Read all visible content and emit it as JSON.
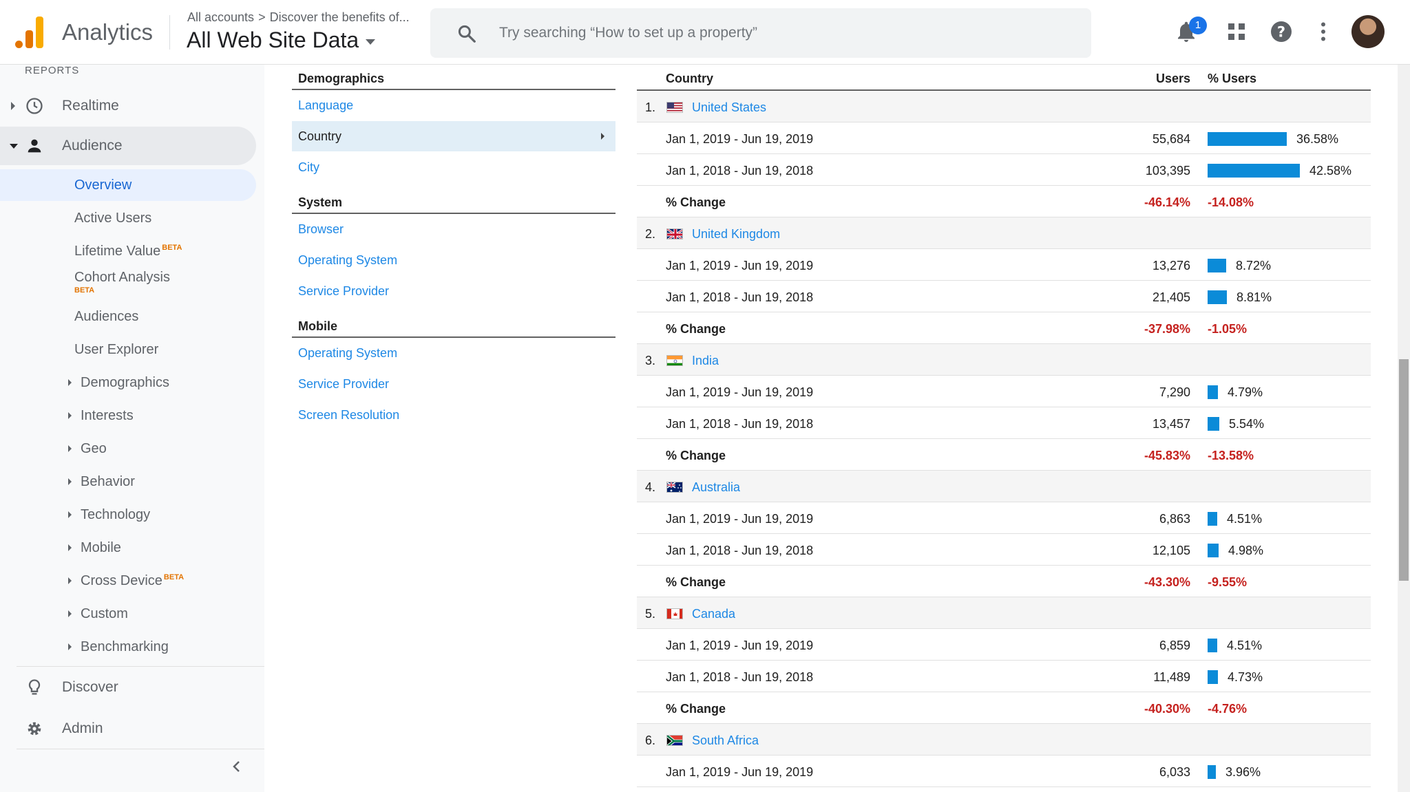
{
  "header": {
    "app_title": "Analytics",
    "breadcrumb_root": "All accounts",
    "breadcrumb_current": "Discover the benefits of...",
    "property": "All Web Site Data",
    "search_placeholder": "Try searching “How to set up a property”",
    "notification_count": "1",
    "icons": [
      "search-icon",
      "bell-icon",
      "apps-icon",
      "help-icon",
      "more-vert-icon"
    ]
  },
  "sidebar": {
    "section_label": "REPORTS",
    "realtime": "Realtime",
    "audience": "Audience",
    "audience_items": {
      "overview": "Overview",
      "active_users": "Active Users",
      "lifetime_value": "Lifetime Value",
      "cohort": "Cohort Analysis",
      "audiences": "Audiences",
      "user_explorer": "User Explorer",
      "demographics": "Demographics",
      "interests": "Interests",
      "geo": "Geo",
      "behavior": "Behavior",
      "technology": "Technology",
      "mobile": "Mobile",
      "cross_device": "Cross Device",
      "custom": "Custom",
      "benchmarking": "Benchmarking"
    },
    "beta_label": "BETA",
    "discover": "Discover",
    "admin": "Admin"
  },
  "dimension_panel": {
    "demographics_title": "Demographics",
    "language": "Language",
    "country": "Country",
    "city": "City",
    "system_title": "System",
    "browser": "Browser",
    "os": "Operating System",
    "provider": "Service Provider",
    "mobile_title": "Mobile",
    "mobile_os": "Operating System",
    "mobile_provider": "Service Provider",
    "screen_res": "Screen Resolution"
  },
  "table": {
    "col_country": "Country",
    "col_users": "Users",
    "col_pct_users": "% Users",
    "change_label": "% Change",
    "bar_color": "#0b8bd8",
    "change_color": "#c5221f",
    "rows": [
      {
        "num": "1.",
        "country": "United States",
        "flag": "us",
        "d1": "Jan 1, 2019 - Jun 19, 2019",
        "u1": "55,684",
        "p1": "36.58%",
        "d2": "Jan 1, 2018 - Jun 19, 2018",
        "u2": "103,395",
        "p2": "42.58%",
        "cu": "-46.14%",
        "cp": "-14.08%"
      },
      {
        "num": "2.",
        "country": "United Kingdom",
        "flag": "uk",
        "d1": "Jan 1, 2019 - Jun 19, 2019",
        "u1": "13,276",
        "p1": "8.72%",
        "d2": "Jan 1, 2018 - Jun 19, 2018",
        "u2": "21,405",
        "p2": "8.81%",
        "cu": "-37.98%",
        "cp": "-1.05%"
      },
      {
        "num": "3.",
        "country": "India",
        "flag": "in",
        "d1": "Jan 1, 2019 - Jun 19, 2019",
        "u1": "7,290",
        "p1": "4.79%",
        "d2": "Jan 1, 2018 - Jun 19, 2018",
        "u2": "13,457",
        "p2": "5.54%",
        "cu": "-45.83%",
        "cp": "-13.58%"
      },
      {
        "num": "4.",
        "country": "Australia",
        "flag": "au",
        "d1": "Jan 1, 2019 - Jun 19, 2019",
        "u1": "6,863",
        "p1": "4.51%",
        "d2": "Jan 1, 2018 - Jun 19, 2018",
        "u2": "12,105",
        "p2": "4.98%",
        "cu": "-43.30%",
        "cp": "-9.55%"
      },
      {
        "num": "5.",
        "country": "Canada",
        "flag": "ca",
        "d1": "Jan 1, 2019 - Jun 19, 2019",
        "u1": "6,859",
        "p1": "4.51%",
        "d2": "Jan 1, 2018 - Jun 19, 2018",
        "u2": "11,489",
        "p2": "4.73%",
        "cu": "-40.30%",
        "cp": "-4.76%"
      },
      {
        "num": "6.",
        "country": "South Africa",
        "flag": "za",
        "d1": "Jan 1, 2019 - Jun 19, 2019",
        "u1": "6,033",
        "p1": "3.96%"
      }
    ]
  }
}
